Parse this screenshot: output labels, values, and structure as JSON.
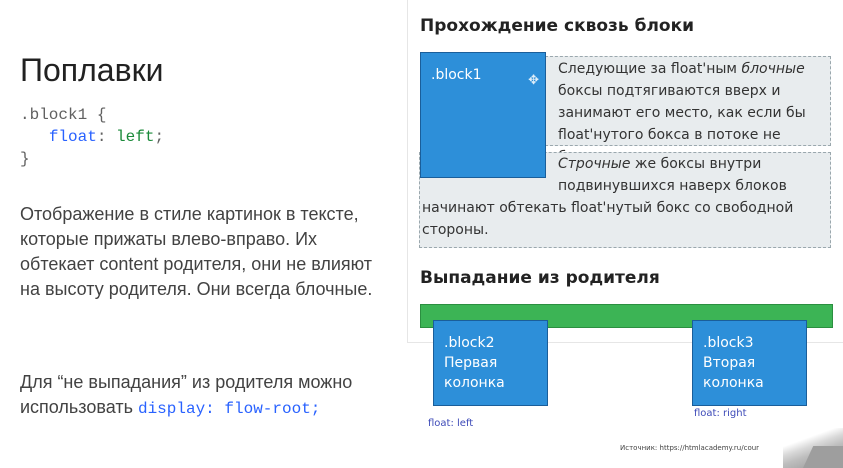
{
  "slide": {
    "title": "Поплавки",
    "code": {
      "line1": ".block1 {",
      "line2_prop": "float",
      "line2_colon": ": ",
      "line2_value": "left",
      "line2_end": ";",
      "line3": "}"
    },
    "paragraph1": "Отображение в стиле картинок в тексте, которые прижаты влево-вправо. Их обтекает content родителя, они не влияют на высоту родителя. Они всегда блочные.",
    "paragraph2_text": "Для “не выпадания” из родителя можно использовать ",
    "paragraph2_code": "display: flow-root;"
  },
  "panel": {
    "heading1": "Прохождение сквозь блоки",
    "block1_label": ".block1",
    "block1_icon": "move-icon",
    "text1": "Следующие за float'ным блочные боксы подтягиваются вверх и занимают его место, как если бы float'нутого бокса в потоке не было.",
    "text1_prefix": "Следующие за float'ным ",
    "text1_italic": "блочные",
    "text1_suffix": " боксы подтягиваются вверх и занимают его место, как если бы float'нутого бокса в потоке не было.",
    "text2_italic": "Строчные",
    "text2_line1_rest": " же боксы внутри",
    "text2_line2": "подвинувшихся наверх блоков",
    "text2_line3": "начинают обтекать float'нутый бокс со свободной",
    "text2_line4": "стороны.",
    "heading2": "Выпадание из родителя",
    "block2": {
      "line1": ".block2",
      "line2": "Первая",
      "line3": "колонка"
    },
    "block3": {
      "line1": ".block3",
      "line2": "Вторая",
      "line3": "колонка"
    },
    "float_left_label": "float: left",
    "float_right_label": "float: right",
    "source": "Источник: https://htmlacademy.ru/cour"
  },
  "colors": {
    "accent_blue": "#2d8fd9",
    "green_bar": "#3cb455",
    "code_keyword": "#2962ff",
    "code_value": "#1b8a3a"
  }
}
